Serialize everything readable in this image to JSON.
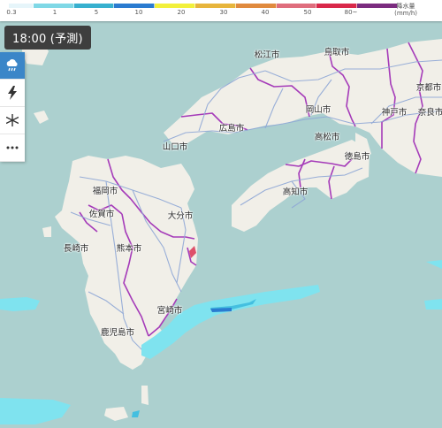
{
  "legend": {
    "ticks": [
      "0.3",
      "1",
      "5",
      "10",
      "20",
      "30",
      "40",
      "50",
      "80~"
    ],
    "unit_line1": "降水量",
    "unit_line2": "(mm/h)",
    "colors": [
      "#e6f5fa",
      "#7fd8e6",
      "#37b0cf",
      "#2a7bd0",
      "#f2f03b",
      "#e7b53c",
      "#e08a3e",
      "#df6d7d",
      "#d9284a",
      "#7b2c7f"
    ]
  },
  "time_label": "18:00 (予測)",
  "tools": [
    {
      "icon": "rain-cloud-icon",
      "active": true
    },
    {
      "icon": "lightning-icon",
      "active": false
    },
    {
      "icon": "snowflake-icon",
      "active": false
    },
    {
      "icon": "more-icon",
      "active": false
    }
  ],
  "cities": [
    {
      "name": "松江市"
    },
    {
      "name": "鳥取市"
    },
    {
      "name": "京都市"
    },
    {
      "name": "岡山市"
    },
    {
      "name": "神戸市"
    },
    {
      "name": "奈良市"
    },
    {
      "name": "広島市"
    },
    {
      "name": "高松市"
    },
    {
      "name": "山口市"
    },
    {
      "name": "徳島市"
    },
    {
      "name": "高知市"
    },
    {
      "name": "福岡市"
    },
    {
      "name": "佐賀市"
    },
    {
      "name": "大分市"
    },
    {
      "name": "長崎市"
    },
    {
      "name": "熊本市"
    },
    {
      "name": "宮崎市"
    },
    {
      "name": "鹿児島市"
    }
  ],
  "colors": {
    "sea": "#acd0cf",
    "land": "#f1efe8",
    "road": "#8fa7d6",
    "border": "#a53bb9",
    "rain_light": "#7fe3ef",
    "rain_mid": "#44bfe0"
  }
}
